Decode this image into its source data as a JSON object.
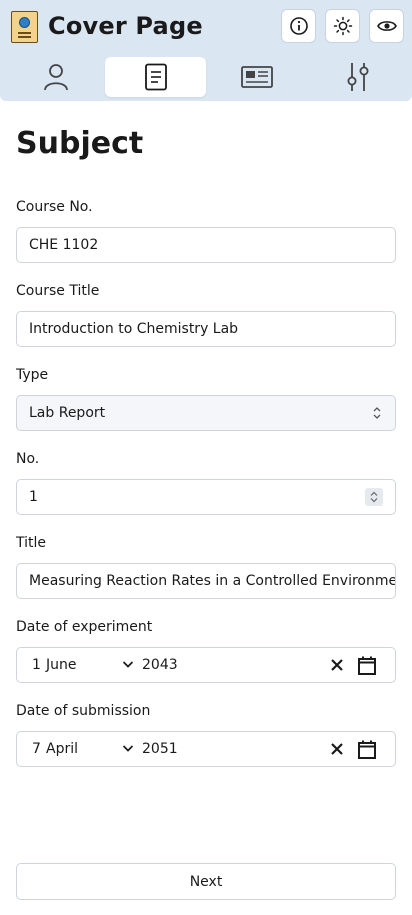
{
  "header": {
    "title": "Cover Page",
    "info_icon": "info-icon",
    "theme_icon": "sun-icon",
    "preview_icon": "eye-icon"
  },
  "tabs": [
    {
      "name": "person",
      "icon": "person-icon",
      "active": false
    },
    {
      "name": "subject",
      "icon": "document-icon",
      "active": true
    },
    {
      "name": "card",
      "icon": "id-card-icon",
      "active": false
    },
    {
      "name": "settings",
      "icon": "sliders-icon",
      "active": false
    }
  ],
  "section": {
    "title": "Subject"
  },
  "form": {
    "course_no": {
      "label": "Course No.",
      "value": "CHE 1102"
    },
    "course_title": {
      "label": "Course Title",
      "value": "Introduction to Chemistry Lab"
    },
    "type": {
      "label": "Type",
      "value": "Lab Report"
    },
    "number": {
      "label": "No.",
      "value": "1"
    },
    "title": {
      "label": "Title",
      "value": "Measuring Reaction Rates in a Controlled Environmen"
    },
    "date_experiment": {
      "label": "Date of experiment",
      "day": "1",
      "month": "June",
      "year": "2043"
    },
    "date_submission": {
      "label": "Date of submission",
      "day": "7",
      "month": "April",
      "year": "2051"
    }
  },
  "actions": {
    "next_label": "Next"
  },
  "colors": {
    "header_bg": "#dbe6f3",
    "border": "#ced4da",
    "active_tab": "#ffffff"
  }
}
